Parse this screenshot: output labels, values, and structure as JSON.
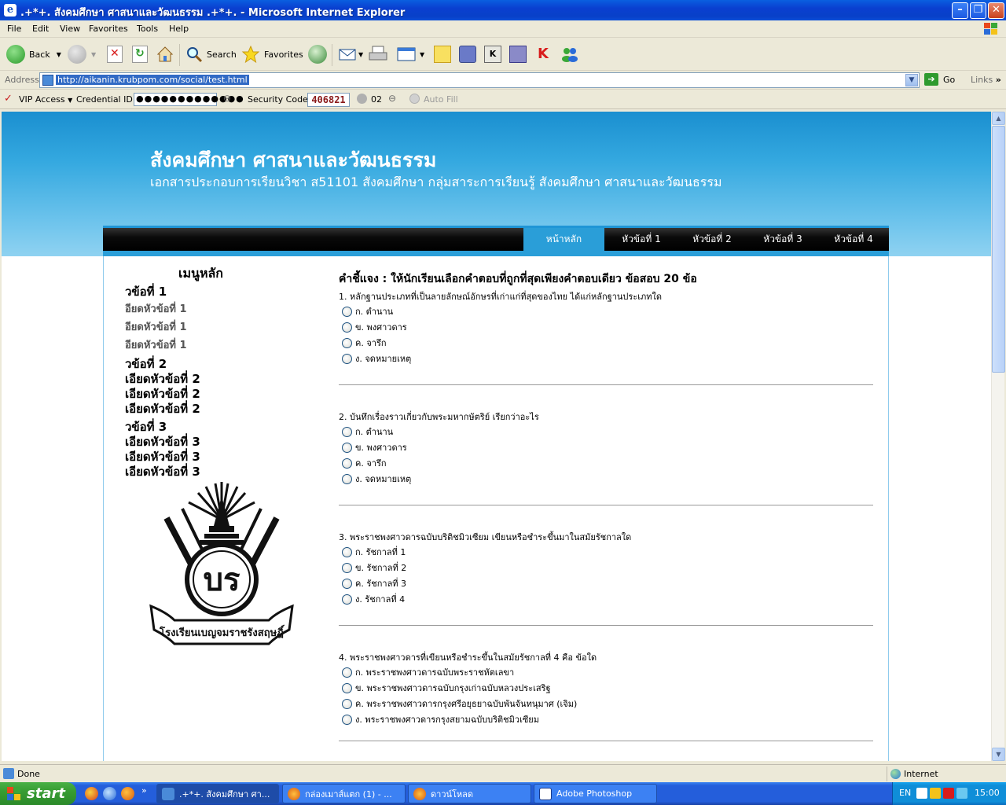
{
  "window": {
    "title": ".+*+. สังคมศึกษา ศาสนาและวัฒนธรรม .+*+. - Microsoft Internet Explorer"
  },
  "menu": [
    "File",
    "Edit",
    "View",
    "Favorites",
    "Tools",
    "Help"
  ],
  "toolbar": {
    "back": "Back",
    "search": "Search",
    "favorites": "Favorites"
  },
  "address": {
    "label": "Address",
    "url": "http://aikanin.krubpom.com/social/test.html",
    "go": "Go",
    "links": "Links"
  },
  "credbar": {
    "vip": "VIP Access",
    "credential_label": "Credential ID:",
    "credential_value": "●●●●●●●●●●●●●",
    "security_label": "Security Code:",
    "security_value": "406821",
    "counter": "02",
    "autofill": "Auto Fill"
  },
  "site": {
    "title": "สังคมศึกษา ศาสนาและวัฒนธรรม",
    "subtitle": "เอกสารประกอบการเรียนวิชา ส51101 สังคมศึกษา  กลุ่มสาระการเรียนรู้  สังคมศึกษา ศาสนาและวัฒนธรรม",
    "nav": [
      "หน้าหลัก",
      "หัวข้อที่ 1",
      "หัวข้อที่ 2",
      "หัวข้อที่ 3",
      "หัวข้อที่ 4"
    ],
    "logo_text": "โรงเรียนเบญจมราชรังสฤษฎิ์"
  },
  "sidebar": {
    "title": "เมนูหลัก",
    "groups": [
      {
        "heading": "วข้อที่ 1",
        "items": [
          "อียดหัวข้อที่ 1",
          "อียดหัวข้อที่ 1",
          "อียดหัวข้อที่ 1"
        ]
      },
      {
        "heading": "วข้อที่ 2",
        "items": [
          "เอียดหัวข้อที่ 2",
          "เอียดหัวข้อที่ 2",
          "เอียดหัวข้อที่ 2"
        ]
      },
      {
        "heading": "วข้อที่ 3",
        "items": [
          "เอียดหัวข้อที่ 3",
          "เอียดหัวข้อที่ 3",
          "เอียดหัวข้อที่ 3"
        ]
      }
    ]
  },
  "quiz": {
    "instruction": "คำชี้แจง : ให้นักเรียนเลือกคำตอบที่ถูกที่สุดเพียงคำตอบเดียว ข้อสอบ 20 ข้อ",
    "questions": [
      {
        "text": "1. หลักฐานประเภทที่เป็นลายลักษณ์อักษรที่เก่าแก่ที่สุดของไทย ได้แก่หลักฐานประเภทใด",
        "options": [
          "ก. ตำนาน",
          "ข. พงศาวดาร",
          "ค. จารึก",
          "ง. จดหมายเหตุ"
        ]
      },
      {
        "text": "2. บันทึกเรื่องราวเกี่ยวกับพระมหากษัตริย์ เรียกว่าอะไร",
        "options": [
          "ก. ตำนาน",
          "ข. พงศาวดาร",
          "ค. จารึก",
          "ง. จดหมายเหตุ"
        ]
      },
      {
        "text": "3. พระราชพงศาวดารฉบับบริติชมิวเซียม เขียนหรือชำระขึ้นมาในสมัยรัชกาลใด",
        "options": [
          "ก. รัชกาลที่ 1",
          "ข. รัชกาลที่ 2",
          "ค. รัชกาลที่ 3",
          "ง. รัชกาลที่ 4"
        ]
      },
      {
        "text": "4. พระราชพงศาวดารที่เขียนหรือชำระขึ้นในสมัยรัชกาลที่ 4 คือ ข้อใด",
        "options": [
          "ก. พระราชพงศาวดารฉบับพระราชหัตเลขา",
          "ข. พระราชพงศาวดารฉบับกรุงเก่าฉบับหลวงประเสริฐ",
          "ค. พระราชพงศาวดารกรุงศรีอยุธยาฉบับพันจันทนุมาศ (เจิม)",
          "ง. พระราชพงศาวดารกรุงสยามฉบับบริติชมิวเซียม"
        ]
      }
    ]
  },
  "status": {
    "done": "Done",
    "zone": "Internet"
  },
  "taskbar": {
    "start": "start",
    "tasks": [
      ".+*+. สังคมศึกษา ศา...",
      "กล่องเมาส์แตก (1) - ...",
      "ดาวน์โหลด",
      "Adobe Photoshop"
    ],
    "lang": "EN",
    "clock": "15:00"
  },
  "colors": {
    "header_top": "#1a8fd0",
    "nav_active": "#2a9ed8",
    "titlebar": "#0a4ed8",
    "taskbar": "#245edb",
    "start": "#379c33"
  }
}
